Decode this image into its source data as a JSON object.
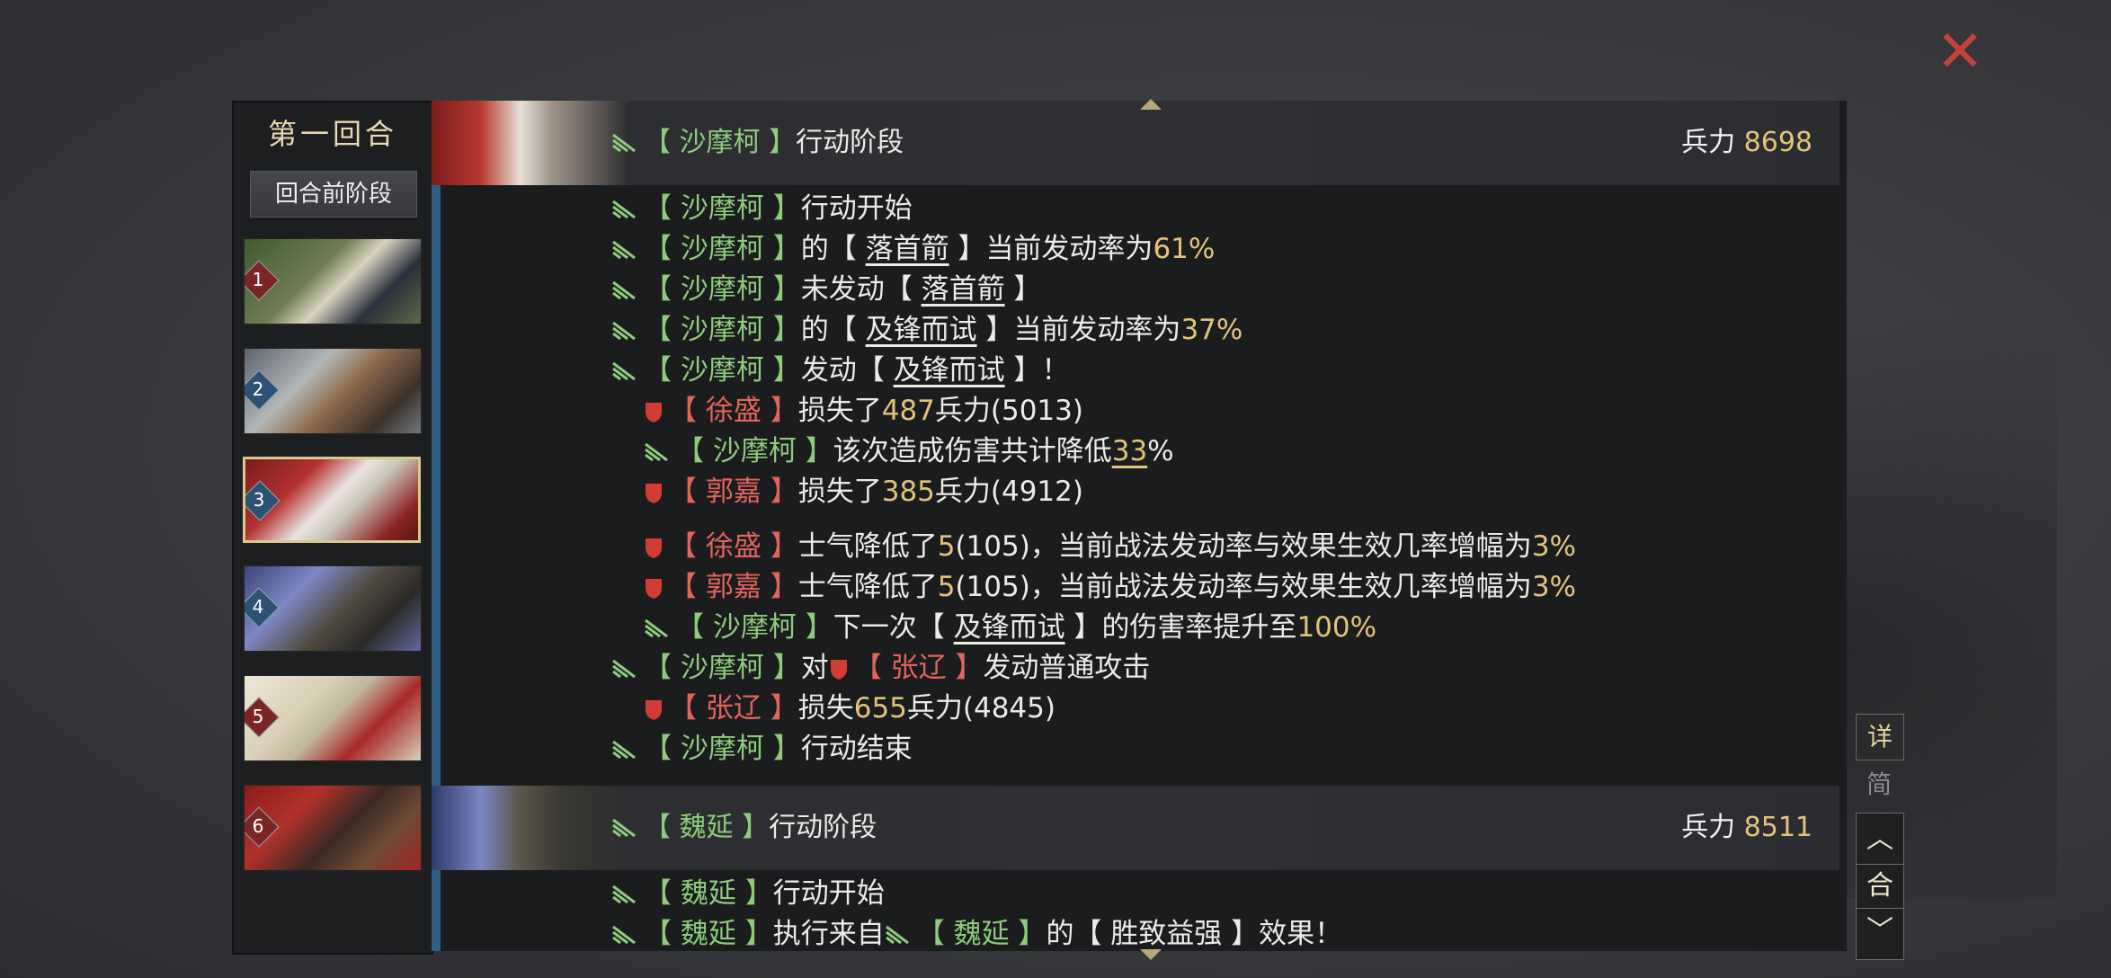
{
  "close_icon": "close-icon",
  "round": {
    "title": "第一回合",
    "pre_phase_label": "回合前阶段"
  },
  "portraits": [
    {
      "num": "1",
      "marker": "red"
    },
    {
      "num": "2",
      "marker": "blue"
    },
    {
      "num": "3",
      "marker": "blue",
      "selected": true
    },
    {
      "num": "4",
      "marker": "blue"
    },
    {
      "num": "5",
      "marker": "red"
    },
    {
      "num": "6",
      "marker": "red"
    }
  ],
  "phase1": {
    "general": "沙摩柯",
    "title_suffix": "行动阶段",
    "troops_label": "兵力",
    "troops_value": "8698"
  },
  "log1": {
    "l1": {
      "name": "沙摩柯",
      "text": "行动开始"
    },
    "l2": {
      "name": "沙摩柯",
      "pre": "的",
      "skill": "落首箭",
      "post": "当前发动率为",
      "val": "61%"
    },
    "l3": {
      "name": "沙摩柯",
      "pre": "未发动",
      "skill": "落首箭"
    },
    "l4": {
      "name": "沙摩柯",
      "pre": "的",
      "skill": "及锋而试",
      "post": "当前发动率为",
      "val": "37%"
    },
    "l5": {
      "name": "沙摩柯",
      "pre": "发动",
      "skill": "及锋而试",
      "post": "！"
    },
    "l6": {
      "name": "徐盛",
      "pre": "损失了",
      "val": "487",
      "post": "兵力(5013)"
    },
    "l7": {
      "name": "沙摩柯",
      "pre": "该次造成伤害共计降低",
      "val": "33",
      "post": "%"
    },
    "l8": {
      "name": "郭嘉",
      "pre": "损失了",
      "val": "385",
      "post": "兵力(4912)"
    },
    "l9": {
      "name": "徐盛",
      "pre": "士气降低了",
      "val": "5",
      "post": "(105)，当前战法发动率与效果生效几率增幅为",
      "val2": "3%"
    },
    "l10": {
      "name": "郭嘉",
      "pre": "士气降低了",
      "val": "5",
      "post": "(105)，当前战法发动率与效果生效几率增幅为",
      "val2": "3%"
    },
    "l11": {
      "name": "沙摩柯",
      "pre": "下一次",
      "skill": "及锋而试",
      "post": "的伤害率提升至",
      "val": "100%"
    },
    "l12": {
      "name": "沙摩柯",
      "pre": "对",
      "target": "张辽",
      "post": "发动普通攻击"
    },
    "l13": {
      "name": "张辽",
      "pre": "损失",
      "val": "655",
      "post": "兵力(4845)"
    },
    "l14": {
      "name": "沙摩柯",
      "text": "行动结束"
    }
  },
  "phase2": {
    "general": "魏延",
    "title_suffix": "行动阶段",
    "troops_label": "兵力",
    "troops_value": "8511"
  },
  "log2": {
    "l1": {
      "name": "魏延",
      "text": "行动开始"
    },
    "l2": {
      "name": "魏延",
      "pre": "执行来自",
      "name2": "魏延",
      "mid": "的",
      "skill": "胜致益强",
      "post": "效果！"
    }
  },
  "controls": {
    "detail": "详",
    "simple": "简",
    "round_nav": "合"
  },
  "colors": {
    "ally_green": "#8ccc7b",
    "enemy_red": "#e2645a",
    "number_yellow": "#e5c27a",
    "accent_blue": "#2f5d84"
  }
}
